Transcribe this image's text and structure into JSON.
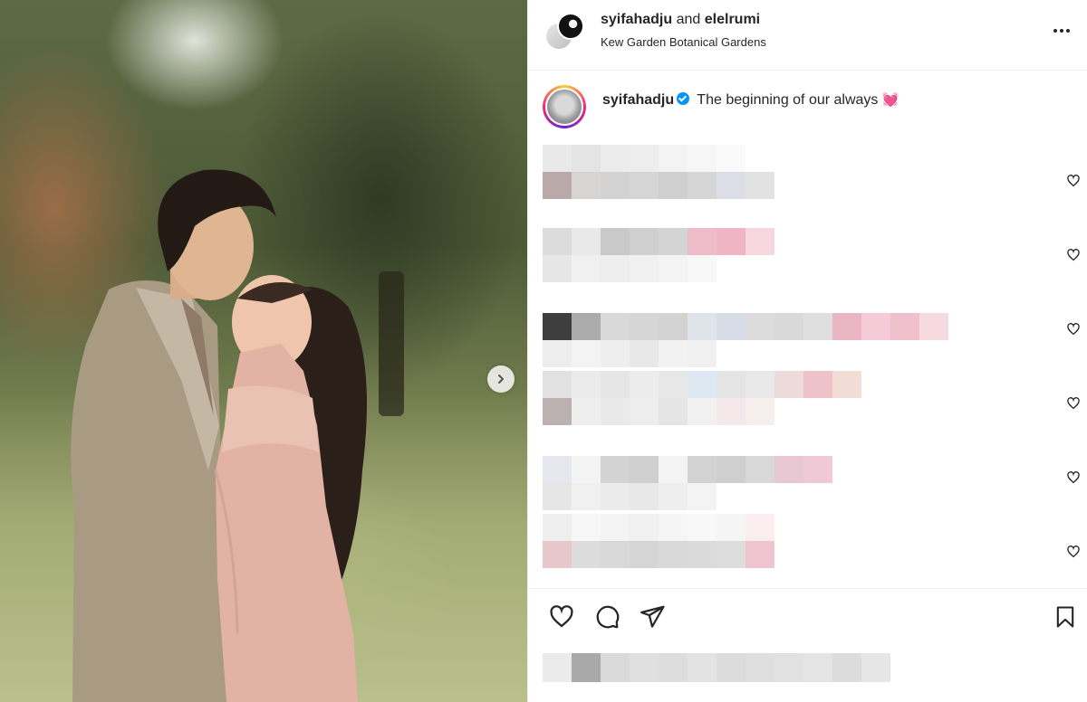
{
  "post": {
    "author": "syifahadju",
    "collaborator_joiner": "and",
    "collaborator": "elelrumi",
    "location": "Kew Garden Botanical Gardens"
  },
  "caption": {
    "username": "syifahadju",
    "text": "The beginning of our always",
    "emoji": "💓"
  },
  "icons": {
    "more": "more-options-icon",
    "verified": "verified-badge-icon",
    "next": "chevron-right-icon",
    "like": "heart-icon",
    "comment": "comment-bubble-icon",
    "share": "paper-plane-icon",
    "save": "bookmark-icon"
  },
  "colors": {
    "verified": "#0095f6",
    "text": "#262626",
    "divider": "#efefef"
  },
  "comments": [
    {
      "pixels_top": [
        "#e9e9e9",
        "#e4e4e4",
        "#ececec",
        "#ededed",
        "#f3f3f3",
        "#f6f6f6",
        "#fafafa"
      ],
      "pixels_bottom": [
        "#b9a9a9",
        "#d8d4d4",
        "#d2d2d2",
        "#d5d5d5",
        "#cfcfcf",
        "#d6d6d6",
        "#dcdde6",
        "#e2e2e2"
      ]
    },
    {
      "pixels_top": [
        "#dcdcdc",
        "#e9e9e9",
        "#c9c9c9",
        "#cfcfcf",
        "#d4d4d4",
        "#eebbc8",
        "#f0b5c5",
        "#f7d7de"
      ],
      "pixels_bottom": [
        "#e6e6e6",
        "#f0f0f0",
        "#eeeeee",
        "#f1f1f1",
        "#f4f4f4",
        "#f8f8f8"
      ]
    },
    {
      "pixels_top": [
        "#3e3e3e",
        "#ababab",
        "#d9d9d9",
        "#d6d6d6",
        "#d3d3d3",
        "#dfe3ea",
        "#d6dde6",
        "#dcdcdc",
        "#d9d9d9",
        "#dfdfdf",
        "#ebb6c4",
        "#f4cbd6",
        "#f0bfcc",
        "#f7d9e0"
      ],
      "pixels_bottom": [
        "#ededed",
        "#f3f3f3",
        "#eeeeee",
        "#e8e8e8",
        "#f2f2f2",
        "#f0f0f0"
      ]
    },
    {
      "pixels_top": [
        "#e1e1e1",
        "#ebebeb",
        "#e6e6e6",
        "#ececec",
        "#e7e7e7",
        "#dde8f2",
        "#e4e4e4",
        "#e9e9e9",
        "#ecdbd9",
        "#edc3c9",
        "#f1dcd6"
      ],
      "pixels_bottom": [
        "#bcb1b1",
        "#eeeeee",
        "#e9e9e9",
        "#ededed",
        "#e5e5e5",
        "#f1f1f1",
        "#f5e8ea",
        "#f7eeee"
      ]
    },
    {
      "pixels_top": [
        "#e6e6ee",
        "#f4f4f4",
        "#d3d3d3",
        "#cfcfcf",
        "#f3f3f3",
        "#d2d2d2",
        "#cfcfcf",
        "#d8d8d8",
        "#e7c8d2",
        "#f0c9d6"
      ],
      "pixels_bottom": [
        "#e6e6e6",
        "#f0f0f0",
        "#ebebeb",
        "#e8e8e8",
        "#eeeeee",
        "#f3f3f3"
      ]
    },
    {
      "pixels_top": [
        "#efefef",
        "#f6f6f6",
        "#f3f3f3",
        "#f1f1f1",
        "#f5f5f5",
        "#f8f8f8",
        "#f5f5f5",
        "#fbeef1"
      ],
      "pixels_bottom": [
        "#e8c7cb",
        "#dcdcdc",
        "#d8d8d8",
        "#d5d5d5",
        "#d9d9d9",
        "#dadada",
        "#dddddd",
        "#efc3cf"
      ]
    }
  ],
  "likes_pixels": [
    "#ebebeb",
    "#a9a9a9",
    "#dadada",
    "#e0e0e0",
    "#dddddd",
    "#e3e3e3",
    "#dcdcdc",
    "#dfdfdf",
    "#e1e1e1",
    "#e4e4e4",
    "#dcdcdc",
    "#e6e6e6"
  ]
}
